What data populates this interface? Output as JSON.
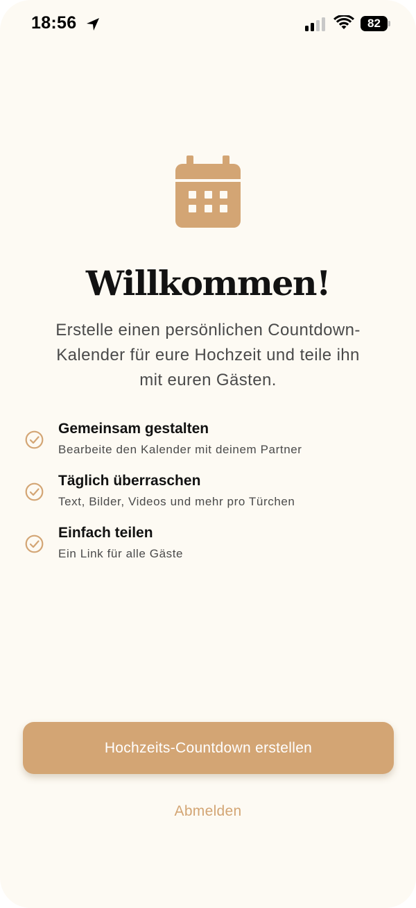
{
  "status_bar": {
    "time": "18:56",
    "battery_level": "82",
    "icons": [
      "location-arrow-icon",
      "cellular-signal-icon",
      "wifi-icon",
      "battery-icon"
    ]
  },
  "hero": {
    "icon": "calendar-icon",
    "title": "Willkommen!",
    "intro_lines": [
      "Erstelle einen persönlichen Countdown-",
      "Kalender für eure Hochzeit und teile ihn",
      "mit euren Gästen."
    ]
  },
  "features": [
    {
      "icon": "check-circle-icon",
      "title": "Gemeinsam gestalten",
      "description": "Bearbeite den Kalender mit deinem Partner"
    },
    {
      "icon": "check-circle-icon",
      "title": "Täglich überraschen",
      "description": "Text, Bilder, Videos und mehr pro Türchen"
    },
    {
      "icon": "check-circle-icon",
      "title": "Einfach teilen",
      "description": "Ein Link für alle Gäste"
    }
  ],
  "actions": {
    "primary_label": "Hochzeits-Countdown erstellen",
    "signout_label": "Abmelden"
  },
  "colors": {
    "background": "#fdfaf3",
    "accent": "#d3a574",
    "title_text": "#121212",
    "body_text": "#4a4a4a"
  }
}
